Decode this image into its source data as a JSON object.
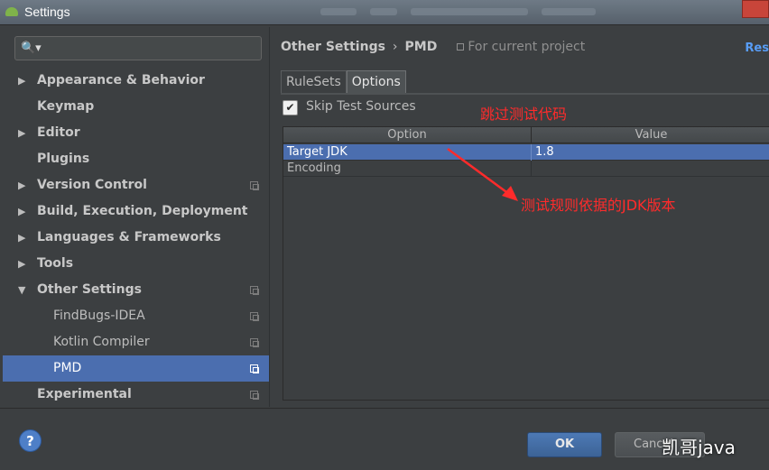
{
  "window": {
    "title": "Settings"
  },
  "search": {
    "icon": "search-icon",
    "value": ""
  },
  "sidebar": {
    "items": [
      {
        "label": "Appearance & Behavior",
        "expandable": true,
        "expanded": false,
        "project": false
      },
      {
        "label": "Keymap",
        "expandable": false,
        "project": false
      },
      {
        "label": "Editor",
        "expandable": true,
        "expanded": false,
        "project": false
      },
      {
        "label": "Plugins",
        "expandable": false,
        "project": false
      },
      {
        "label": "Version Control",
        "expandable": true,
        "expanded": false,
        "project": true
      },
      {
        "label": "Build, Execution, Deployment",
        "expandable": true,
        "expanded": false,
        "project": false
      },
      {
        "label": "Languages & Frameworks",
        "expandable": true,
        "expanded": false,
        "project": false
      },
      {
        "label": "Tools",
        "expandable": true,
        "expanded": false,
        "project": false
      },
      {
        "label": "Other Settings",
        "expandable": true,
        "expanded": true,
        "project": true
      },
      {
        "label": "FindBugs-IDEA",
        "child": true,
        "project": true
      },
      {
        "label": "Kotlin Compiler",
        "child": true,
        "project": true
      },
      {
        "label": "PMD",
        "child": true,
        "project": true,
        "selected": true
      },
      {
        "label": "Experimental",
        "expandable": false,
        "project": true
      }
    ]
  },
  "breadcrumb": {
    "parent": "Other Settings",
    "separator": "›",
    "current": "PMD",
    "scope": "For current project"
  },
  "reset_link": "Res",
  "tabs": [
    {
      "label": "RuleSets",
      "active": false
    },
    {
      "label": "Options",
      "active": true
    }
  ],
  "options": {
    "skip_test_sources": {
      "label": "Skip Test Sources",
      "checked": true,
      "check_glyph": "✔"
    },
    "table": {
      "headers": [
        "Option",
        "Value"
      ],
      "rows": [
        {
          "option": "Target JDK",
          "value": "1.8",
          "selected": true
        },
        {
          "option": "Encoding",
          "value": "",
          "selected": false
        }
      ]
    }
  },
  "annotations": {
    "skip_note": "跳过测试代码",
    "jdk_note": "测试规则依据的JDK版本",
    "color": "#ff2b2b"
  },
  "buttons": {
    "help": "?",
    "ok": "OK",
    "cancel": "Cancel"
  },
  "watermark": "凯哥java",
  "colors": {
    "selection": "#4b6eaf",
    "background": "#3c3f41",
    "link": "#589df6"
  }
}
